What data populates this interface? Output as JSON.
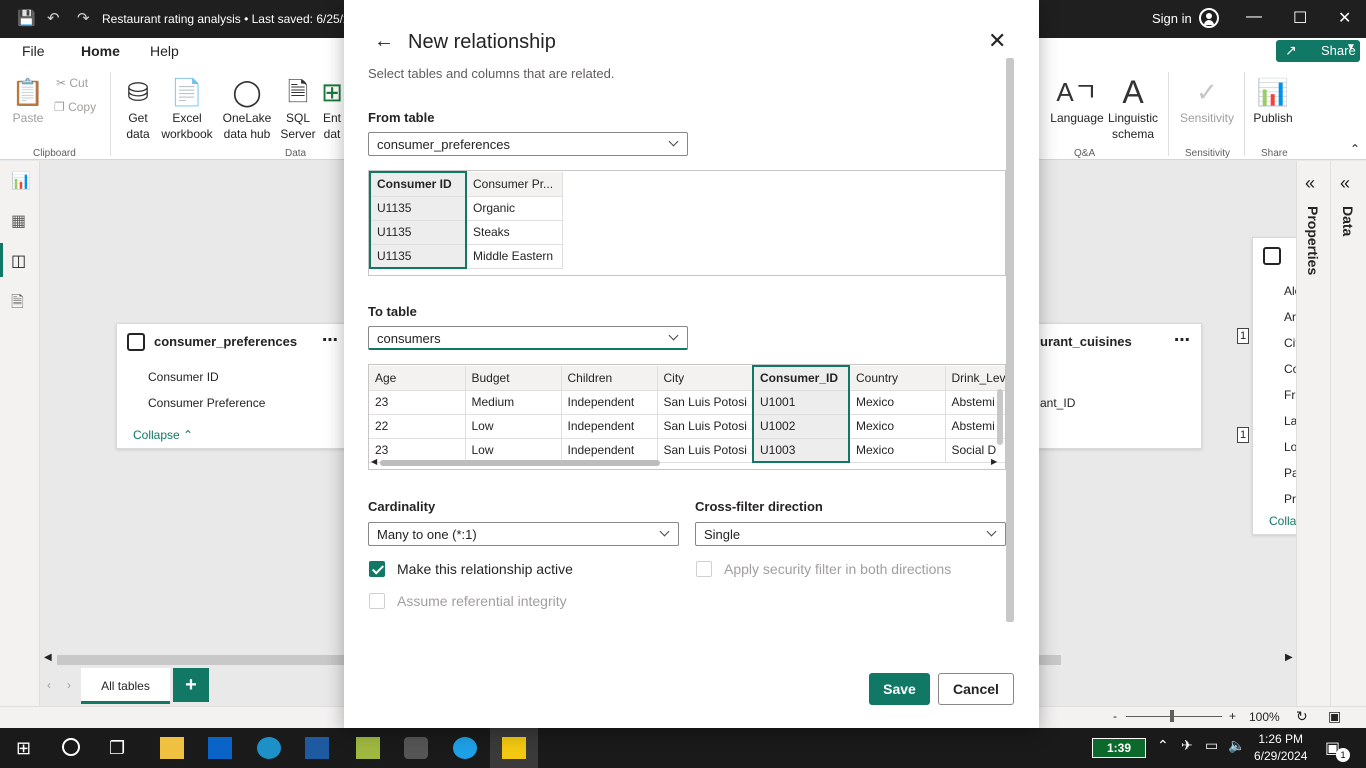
{
  "window": {
    "title": "Restaurant rating analysis • Last saved: 6/25/2",
    "sign_in": "Sign in"
  },
  "menu": {
    "file": "File",
    "home": "Home",
    "help": "Help",
    "share": "Share"
  },
  "ribbon": {
    "paste": "Paste",
    "cut": "Cut",
    "copy": "Copy",
    "clipboard_group": "Clipboard",
    "get_data": "Get data",
    "excel": "Excel workbook",
    "onelake": "OneLake data hub",
    "sql": "SQL Server",
    "enter": "Ent dat",
    "data_group": "Data",
    "language": "Language",
    "linguistic": "Linguistic schema",
    "qa_group": "Q&A",
    "sensitivity": "Sensitivity",
    "sensitivity_group": "Sensitivity",
    "publish": "Publish",
    "share_group": "Share"
  },
  "canvas": {
    "card1": {
      "title": "consumer_preferences",
      "fields": [
        "Consumer ID",
        "Consumer Preference"
      ],
      "collapse": "Collapse"
    },
    "card2": {
      "title": "urant_cuisines",
      "fields": [
        "ant_ID"
      ]
    },
    "card3": {
      "fields": [
        "Alc",
        "Ar",
        "Cit",
        "Co",
        "Fra",
        "La",
        "Lo",
        "Pa",
        "Pr"
      ],
      "collapse": "Colla"
    },
    "cardinality_marks": [
      "1",
      "1"
    ]
  },
  "panes": {
    "properties": "Properties",
    "data": "Data"
  },
  "tabs": {
    "all_tables": "All tables",
    "add": "+"
  },
  "status": {
    "zoom": "100%"
  },
  "taskbar": {
    "time": "1:26 PM",
    "date": "6/29/2024",
    "battery": "1:39",
    "notif_count": "1"
  },
  "dialog": {
    "title": "New relationship",
    "subtitle": "Select tables and columns that are related.",
    "from_label": "From table",
    "from_table": "consumer_preferences",
    "from_columns": [
      "Consumer ID",
      "Consumer Pr..."
    ],
    "from_rows": [
      [
        "U1135",
        "Organic"
      ],
      [
        "U1135",
        "Steaks"
      ],
      [
        "U1135",
        "Middle Eastern"
      ]
    ],
    "to_label": "To table",
    "to_table": "consumers",
    "to_columns": [
      "Age",
      "Budget",
      "Children",
      "City",
      "Consumer_ID",
      "Country",
      "Drink_Leve"
    ],
    "to_rows": [
      [
        "23",
        "Medium",
        "Independent",
        "San Luis Potosi",
        "U1001",
        "Mexico",
        "Abstemi"
      ],
      [
        "22",
        "Low",
        "Independent",
        "San Luis Potosi",
        "U1002",
        "Mexico",
        "Abstemi"
      ],
      [
        "23",
        "Low",
        "Independent",
        "San Luis Potosi",
        "U1003",
        "Mexico",
        "Social D"
      ]
    ],
    "cardinality_label": "Cardinality",
    "cardinality_value": "Many to one (*:1)",
    "crossfilter_label": "Cross-filter direction",
    "crossfilter_value": "Single",
    "active_label": "Make this relationship active",
    "security_label": "Apply security filter in both directions",
    "integrity_label": "Assume referential integrity",
    "save": "Save",
    "cancel": "Cancel"
  }
}
